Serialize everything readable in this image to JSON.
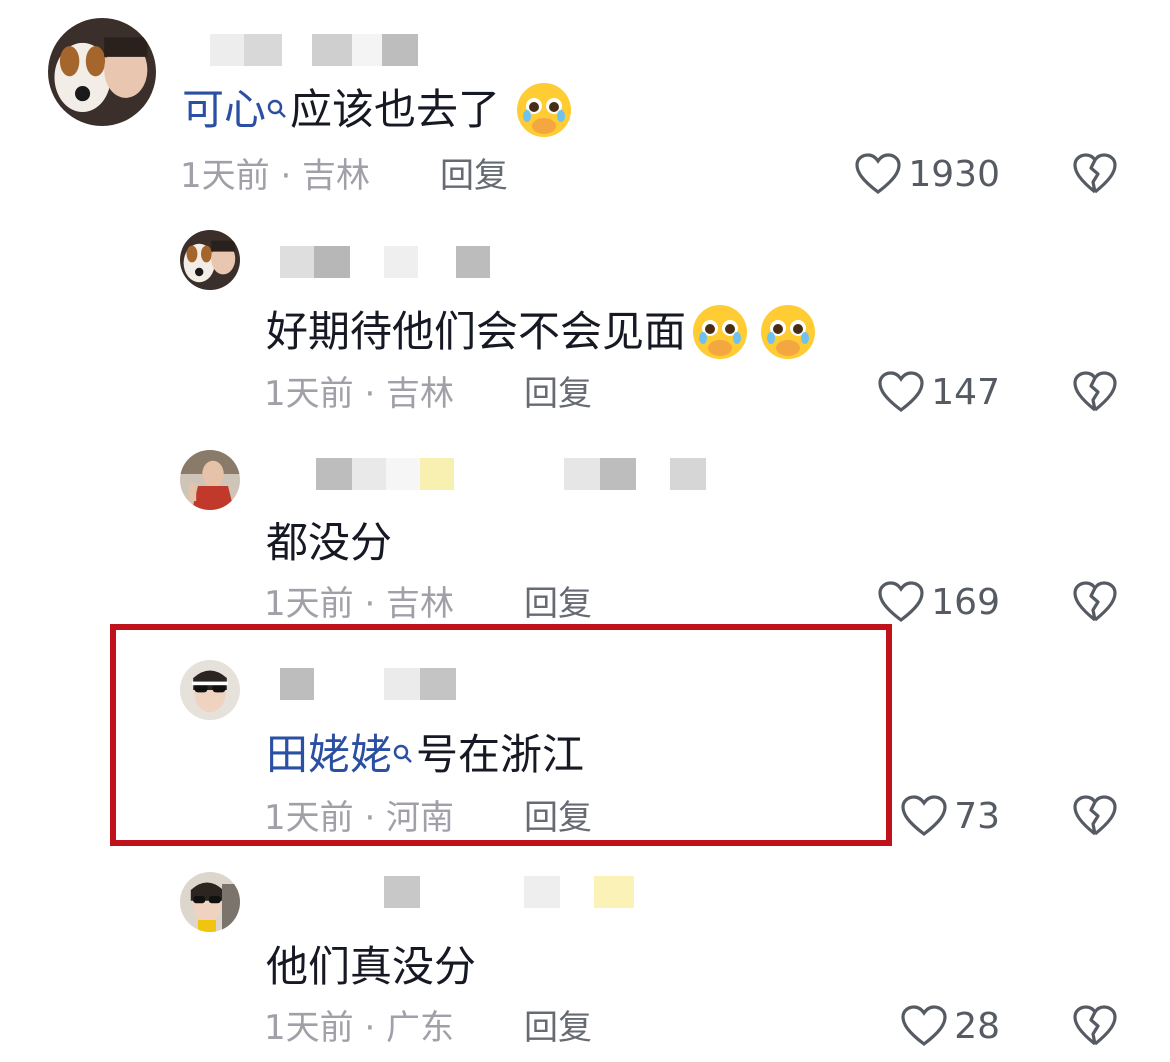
{
  "comments": [
    {
      "mention": "可心",
      "text": "应该也去了",
      "emoji": [
        "pleading-face-emoji"
      ],
      "time_location": "1天前 · 吉林",
      "reply_label": "回复",
      "likes": "1930"
    },
    {
      "text": "好期待他们会不会见面",
      "emoji": [
        "pleading-face-emoji",
        "pleading-face-emoji"
      ],
      "time_location": "1天前 · 吉林",
      "reply_label": "回复",
      "likes": "147"
    },
    {
      "text": "都没分",
      "time_location": "1天前 · 吉林",
      "reply_label": "回复",
      "likes": "169"
    },
    {
      "mention": "田姥姥",
      "text": "号在浙江",
      "time_location": "1天前 · 河南",
      "reply_label": "回复",
      "likes": "73",
      "highlighted": true
    },
    {
      "text": "他们真没分",
      "time_location": "1天前 · 广东",
      "reply_label": "回复",
      "likes": "28"
    }
  ],
  "icons": {
    "like": "heart-outline-icon",
    "dislike": "broken-heart-icon",
    "mention": "search-icon"
  },
  "colors": {
    "mention": "#2b4fa2",
    "highlight_border": "#c0121b",
    "meta": "#a0a0a8"
  }
}
